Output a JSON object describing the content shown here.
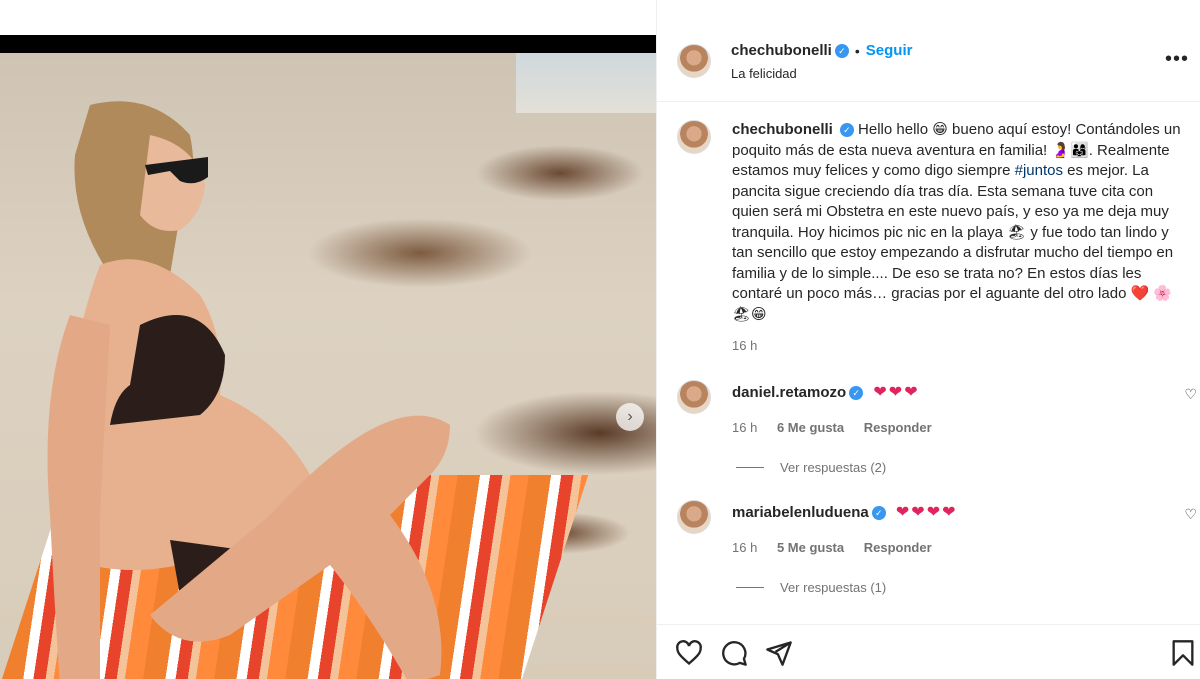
{
  "post": {
    "author": "chechubonelli",
    "follow_label": "Seguir",
    "location": "La felicidad",
    "more_label": "•••"
  },
  "caption": {
    "author": "chechubonelli",
    "text_before_hashtag": "Hello hello 😁 bueno aquí estoy! Contándoles un poquito más de esta nueva aventura en familia! 🤰👨‍👩‍👧. Realmente estamos muy felices y como digo siempre",
    "hashtag": "#juntos",
    "text_after_hashtag": "es mejor. La pancita sigue creciendo día tras día. Esta semana tuve cita con quien será mi Obstetra en este nuevo país, y eso ya me deja muy tranquila. Hoy hicimos pic nic en la playa 🏖 y fue todo tan lindo y tan sencillo que estoy empezando a disfrutar mucho del tiempo en familia y de lo simple.... De eso se trata no? En estos días les contaré un poco más… gracias por el aguante del otro lado ❤️ 🌸🏖😁",
    "time": "16 h"
  },
  "comments": [
    {
      "username": "daniel.retamozo",
      "text": "❤❤❤",
      "time": "16 h",
      "likes": "6 Me gusta",
      "reply_label": "Responder",
      "view_replies": "Ver respuestas (2)"
    },
    {
      "username": "mariabelenluduena",
      "text": "❤❤❤❤",
      "time": "16 h",
      "likes": "5 Me gusta",
      "reply_label": "Responder",
      "view_replies": "Ver respuestas (1)"
    }
  ],
  "icons": {
    "verified": "verified-badge-icon",
    "like": "heart-icon",
    "comment": "comment-icon",
    "share": "share-icon",
    "save": "bookmark-icon",
    "carousel_next": "chevron-right-icon"
  },
  "colors": {
    "link": "#0095f6",
    "hashtag": "#00376b",
    "verified": "#3897f0",
    "heart": "#e0245e",
    "muted": "#737373"
  }
}
